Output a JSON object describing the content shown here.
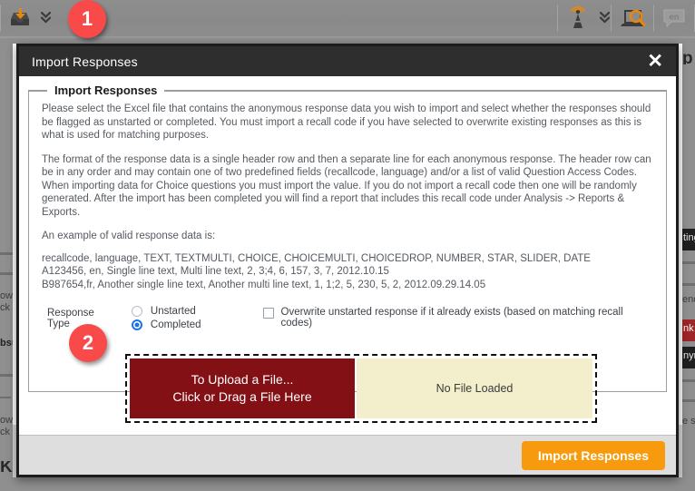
{
  "toolbar": {
    "left_items": [
      {
        "name": "import-responses-icon",
        "title": "Import Responses"
      },
      {
        "name": "import-dropdown-chevron",
        "title": "More import options"
      }
    ],
    "right_items": [
      {
        "name": "broadcast-icon",
        "title": "Launch / Broadcast Survey"
      },
      {
        "name": "broadcast-dropdown-chevron",
        "title": "More launch options"
      },
      {
        "name": "preview-survey-icon",
        "title": "Preview Survey"
      },
      {
        "name": "language-icon",
        "label": "en",
        "title": "Language"
      }
    ]
  },
  "badges": [
    {
      "number": "1"
    },
    {
      "number": "2"
    }
  ],
  "modal": {
    "title": "Import Responses",
    "close_label": "✕",
    "fieldset_legend": "Import Responses",
    "paragraphs": [
      "Please select the Excel file that contains the anonymous response data you wish to import and select whether the responses should be flagged as unstarted or completed. You must import a recall code if you have selected to overwrite existing responses as this is what is used for matching purposes.",
      "The format of the response data is a single header row and then a separate line for each anonymous response. The header row can be in any order and may contain one of two predefined fields (recallcode, language) and/or a list of valid Question Access Codes. When importing data for Choice questions you must import the value. If you do not import a recall code then one will be randomly generated. After the import has been completed you will find a report that includes this recall code under Analysis -> Reports & Exports.",
      "An example of valid response data is:"
    ],
    "sample_lines": [
      "recallcode, language, TEXT, TEXTMULTI, CHOICE, CHOICEMULTI, CHOICEDROP, NUMBER, STAR, SLIDER, DATE",
      "A123456, en, Single line text, Multi line text, 2, 3;4, 6, 157, 3, 7, 2012.10.15",
      "B987654,fr, Another single line text, Another multi line text, 1, 1;2, 5, 230, 5, 2, 2012.09.29.14.05"
    ],
    "response_type": {
      "label": "Response Type",
      "options": [
        {
          "label": "Unstarted",
          "selected": false
        },
        {
          "label": "Completed",
          "selected": true
        }
      ]
    },
    "overwrite": {
      "label": "Overwrite unstarted response if it already exists (based on matching recall codes)",
      "checked": false
    },
    "upload": {
      "dropbox_line1": "To Upload a File...",
      "dropbox_line2": "Click or Drag a File Here",
      "file_status": "No File Loaded"
    },
    "footer": {
      "submit_label": "Import Responses"
    }
  },
  "background": {
    "left_fragments": [
      "ow i",
      "ck th",
      "bsu",
      "ow i",
      "ck th",
      "KE"
    ],
    "right_fragments": [
      "p",
      "ting",
      "end",
      "nk",
      "nym",
      "e se"
    ]
  },
  "colors": {
    "accent_orange": "#f79a0e",
    "badge_red": "#f94a4a",
    "upload_dark_red": "#821015",
    "file_status_cream": "#f3eecb",
    "radio_blue": "#1a73e8",
    "titlebar_dark": "#2e2e2e",
    "toolbar_gray": "#8f8f8f"
  }
}
